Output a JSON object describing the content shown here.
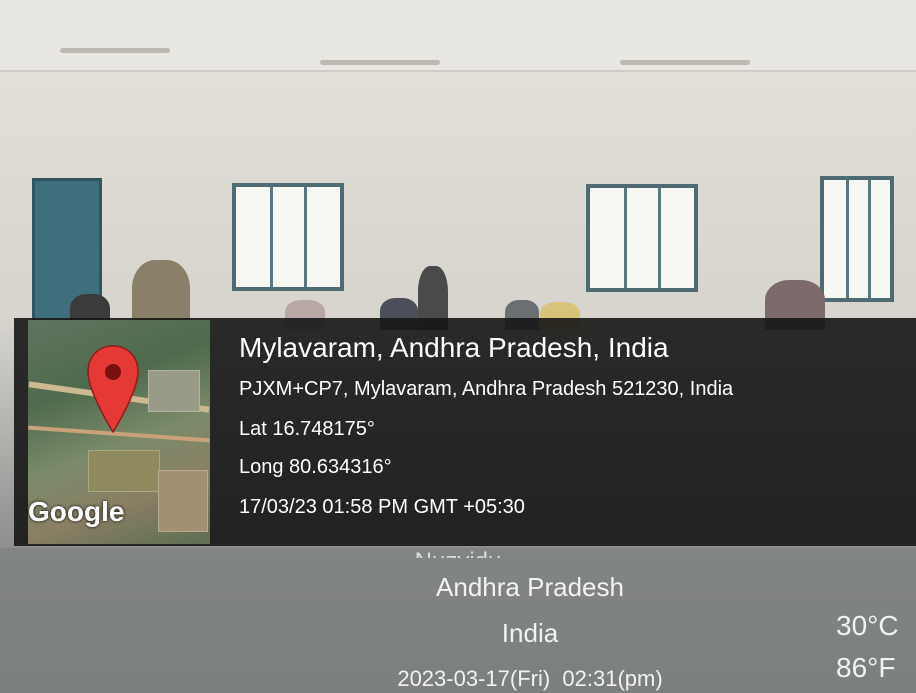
{
  "geotag": {
    "title": "Mylavaram, Andhra Pradesh, India",
    "address": "PJXM+CP7, Mylavaram, Andhra Pradesh 521230, India",
    "lat": "Lat 16.748175°",
    "long": "Long 80.634316°",
    "datetime": "17/03/23 01:58 PM GMT +05:30",
    "map_brand": "Google",
    "pin_icon": "map-pin-icon",
    "pin_color": "#e53935"
  },
  "watermark": {
    "city_partial": "Nuzvidu",
    "state": "Andhra Pradesh",
    "country": "India",
    "timestamp": "2023-03-17(Fri)  02:31(pm)",
    "temp_c": "30°C",
    "temp_f": "86°F"
  }
}
